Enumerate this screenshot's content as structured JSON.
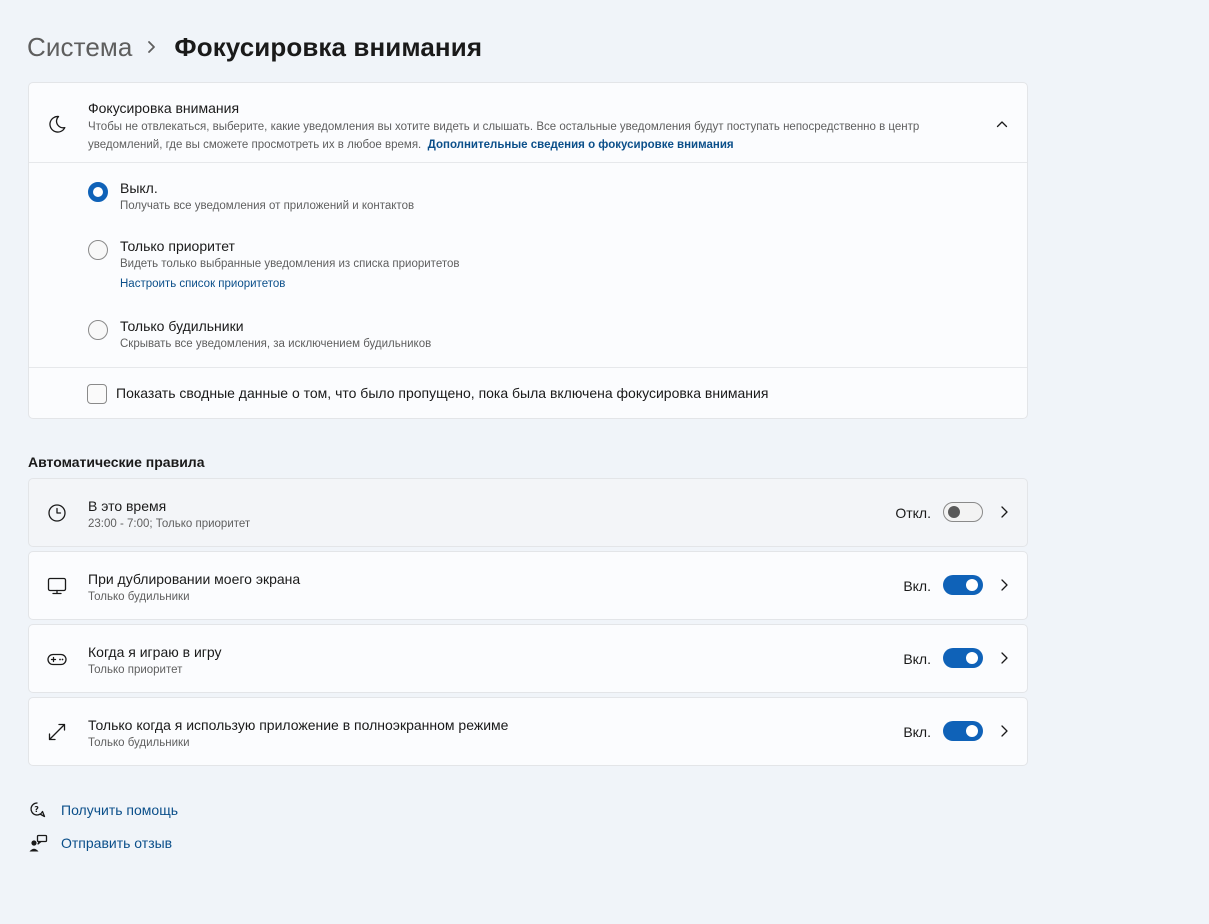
{
  "breadcrumb": {
    "parent": "Система",
    "current": "Фокусировка внимания"
  },
  "focus": {
    "title": "Фокусировка внимания",
    "description": "Чтобы не отвлекаться, выберите, какие уведомления вы хотите видеть и слышать. Все остальные уведомления будут поступать непосредственно в центр уведомлений, где вы сможете просмотреть их в любое время.",
    "link": "Дополнительные сведения о фокусировке внимания",
    "options": [
      {
        "label": "Выкл.",
        "description": "Получать все уведомления от приложений и контактов",
        "checked": true
      },
      {
        "label": "Только приоритет",
        "description": "Видеть только выбранные уведомления из списка приоритетов",
        "link": "Настроить список приоритетов",
        "checked": false
      },
      {
        "label": "Только будильники",
        "description": "Скрывать все уведомления, за исключением будильников",
        "checked": false
      }
    ],
    "summary_checkbox": {
      "label": "Показать сводные данные о том, что было пропущено, пока была включена фокусировка внимания",
      "checked": false
    }
  },
  "rules": {
    "title": "Автоматические правила",
    "items": [
      {
        "icon": "clock-icon",
        "title": "В это время",
        "subtitle": "23:00 - 7:00; Только приоритет",
        "state": "Откл.",
        "on": false
      },
      {
        "icon": "monitor-icon",
        "title": "При дублировании моего экрана",
        "subtitle": "Только будильники",
        "state": "Вкл.",
        "on": true
      },
      {
        "icon": "gamepad-icon",
        "title": "Когда я играю в игру",
        "subtitle": "Только приоритет",
        "state": "Вкл.",
        "on": true
      },
      {
        "icon": "fullscreen-icon",
        "title": "Только когда я использую приложение в полноэкранном режиме",
        "subtitle": "Только будильники",
        "state": "Вкл.",
        "on": true
      }
    ]
  },
  "footer": {
    "help": "Получить помощь",
    "feedback": "Отправить отзыв"
  },
  "colors": {
    "accent": "#0f62b8",
    "link": "#0b4f8a",
    "background": "#f0f4f9"
  }
}
